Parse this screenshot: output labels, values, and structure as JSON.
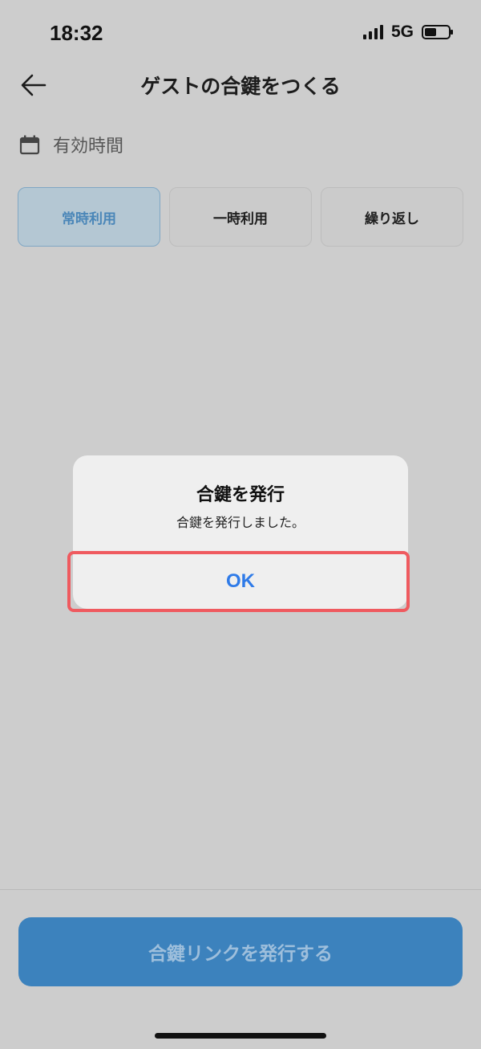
{
  "status_bar": {
    "time": "18:32",
    "network": "5G",
    "battery_level": 0.5
  },
  "header": {
    "title": "ゲストの合鍵をつくる",
    "back_icon": "arrow-left-icon"
  },
  "validity": {
    "label": "有効時間",
    "icon": "calendar-icon"
  },
  "tabs": [
    {
      "label": "常時利用",
      "active": true
    },
    {
      "label": "一時利用",
      "active": false
    },
    {
      "label": "繰り返し",
      "active": false
    }
  ],
  "alert": {
    "title": "合鍵を発行",
    "message": "合鍵を発行しました。",
    "ok_label": "OK"
  },
  "footer": {
    "issue_button_label": "合鍵リンクを発行する"
  },
  "colors": {
    "accent": "#3c82bd",
    "alert_button": "#2f7be8",
    "highlight": "#ef5a5f",
    "background": "#cdcdcd"
  }
}
